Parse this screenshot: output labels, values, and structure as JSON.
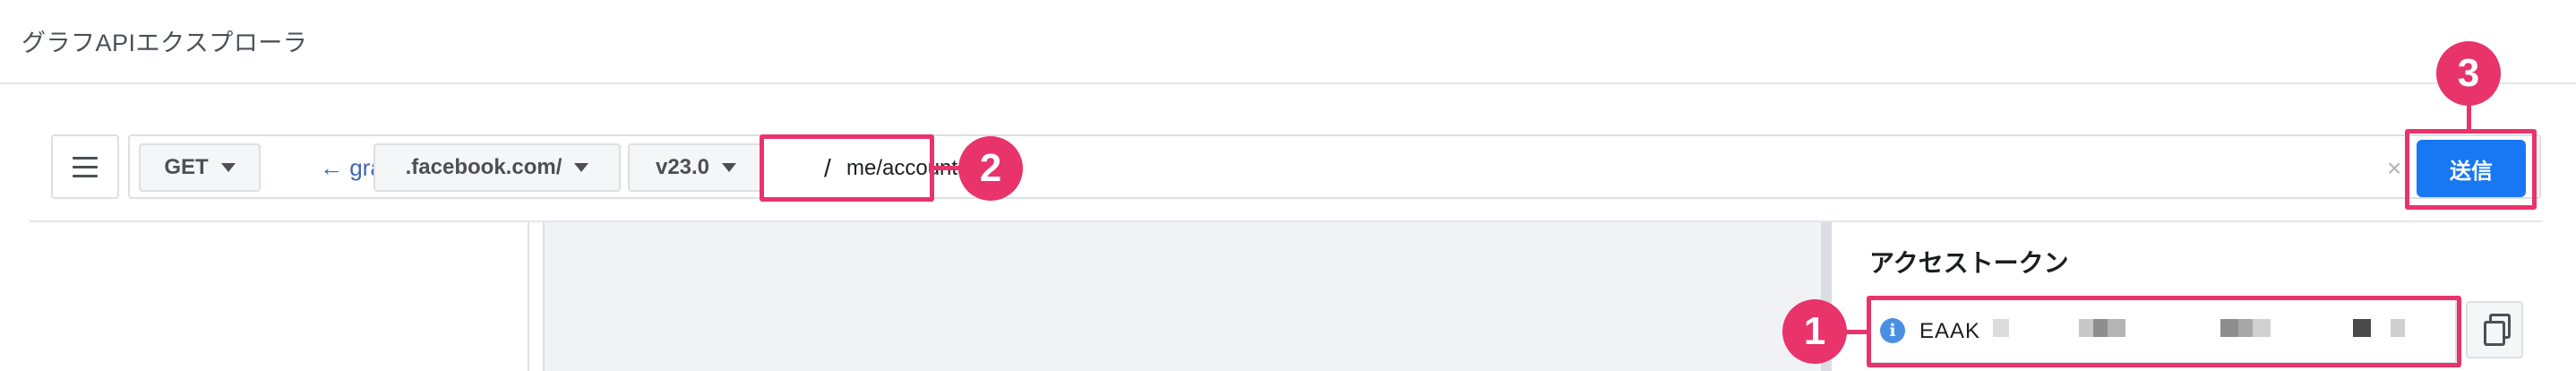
{
  "app": {
    "title": "グラフAPIエクスプローラ"
  },
  "toolbar": {
    "method": "GET",
    "host_prefix": "← graph.",
    "domain": ".facebook.com/",
    "version": "v23.0",
    "path_separator": "/",
    "path": "me/accounts",
    "clear_symbol": "×",
    "favorite_symbol": "★",
    "submit_label": "送信"
  },
  "access_token": {
    "heading": "アクセストークン",
    "info_symbol": "i",
    "value_prefix": "EAAK"
  },
  "annotations": {
    "callout_1": "1",
    "callout_2": "2",
    "callout_3": "3",
    "color": "#e8336b"
  },
  "icons": [
    "menu-icon",
    "dropdown-caret-icon",
    "clear-icon",
    "star-icon",
    "info-icon",
    "copy-icon"
  ]
}
